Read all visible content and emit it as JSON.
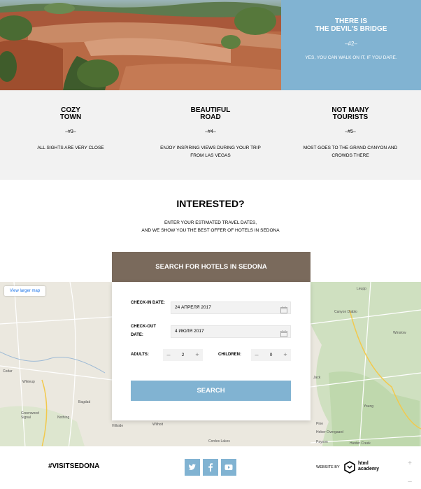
{
  "hero": {
    "title": "There is\nthe Devil's Bridge",
    "number": "–#2–",
    "description": "Yes, you can walk on it, if you dare."
  },
  "features": [
    {
      "title": "Cozy\ntown",
      "number": "–#3–",
      "description": "All sights are very close"
    },
    {
      "title": "Beautiful\nroad",
      "number": "–#4–",
      "description": "Enjoy inspiring views during your trip from Las Vegas"
    },
    {
      "title": "Not many\ntourists",
      "number": "–#5–",
      "description": "Most goes to the Grand Canyon and crowds there"
    }
  ],
  "interested": {
    "title": "INTERESTED?",
    "line1": "Enter your estimated travel dates,",
    "line2": "and we show you the best offer of hotels in Sedona"
  },
  "search": {
    "heading": "Search for hotels in Sedona",
    "checkin_label": "Check-in date:",
    "checkin_value": "24 апреля 2017",
    "checkout_label": "Check-out date:",
    "checkout_value": "4 июля 2017",
    "adults_label": "Adults:",
    "adults_value": "2",
    "children_label": "Children:",
    "children_value": "0",
    "minus": "–",
    "plus": "+",
    "button": "Search"
  },
  "map": {
    "view_larger": "View larger map",
    "places": [
      "Leupp",
      "Canyon Diablo",
      "Winslow",
      "Cedar",
      "Wikieup",
      "Bagdad",
      "Greenwood Signal",
      "Nothing",
      "Hillside",
      "Wilhoit",
      "Cordes Lakes",
      "Jack",
      "Pine",
      "Heber-Overgaard",
      "Payson",
      "Young",
      "Hunter Creek"
    ]
  },
  "footer": {
    "hashtag": "#visitsedona",
    "website_by": "Website by",
    "academy_line1": "html",
    "academy_line2": "academy"
  },
  "icons": [
    "twitter-icon",
    "facebook-icon",
    "youtube-icon",
    "calendar-icon",
    "html-academy-logo-icon"
  ],
  "colors": {
    "accent": "#81b3d2",
    "brown": "#7a6a5c",
    "gray_bg": "#f2f2f2"
  }
}
